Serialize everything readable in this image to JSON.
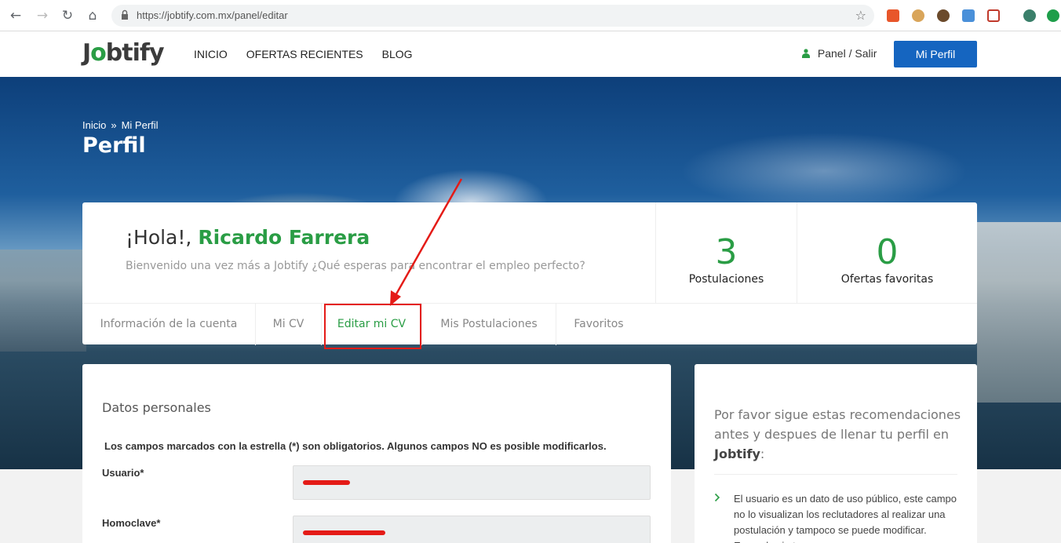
{
  "browser": {
    "url": "https://jobtify.com.mx/panel/editar",
    "back": "←",
    "forward": "→",
    "reload": "↻",
    "home": "⌂",
    "star": "☆"
  },
  "header": {
    "logo_pre": "J",
    "logo_o": "o",
    "logo_post": "btify",
    "nav": [
      "INICIO",
      "OFERTAS RECIENTES",
      "BLOG"
    ],
    "panel_link": "Panel / Salir",
    "profile_button": "Mi Perfil"
  },
  "hero": {
    "breadcrumb_home": "Inicio",
    "breadcrumb_sep": "»",
    "breadcrumb_current": "Mi Perfil",
    "title": "Perfil"
  },
  "profile": {
    "greeting": "¡Hola!,",
    "name": "Ricardo Farrera",
    "welcome": "Bienvenido una vez más a Jobtify ¿Qué esperas para encontrar el empleo perfecto?",
    "stats": [
      {
        "value": "3",
        "label": "Postulaciones"
      },
      {
        "value": "0",
        "label": "Ofertas favoritas"
      }
    ],
    "tabs": [
      "Información de la cuenta",
      "Mi CV",
      "Editar mi CV",
      "Mis Postulaciones",
      "Favoritos"
    ],
    "active_tab": "Editar mi CV"
  },
  "form": {
    "title": "Datos personales",
    "note": "Los campos marcados con la estrella (*) son obligatorios. Algunos campos NO es posible modificarlos.",
    "fields": [
      {
        "label": "Usuario*"
      },
      {
        "label": "Homoclave*"
      }
    ]
  },
  "recommendations": {
    "title_pre": "Por favor sigue estas recomendaciones antes y despues de llenar tu perfil en",
    "title_brand": "Jobtify",
    "title_post": ":",
    "items": [
      "El usuario es un dato de uso público, este campo no lo visualizan los reclutadores al realizar una postulación y tampoco se puede modificar. Esperale sin tener que..."
    ]
  },
  "colors": {
    "brand_green": "#2a9d45",
    "button_blue": "#1565c0",
    "annotation_red": "#e41b17"
  }
}
